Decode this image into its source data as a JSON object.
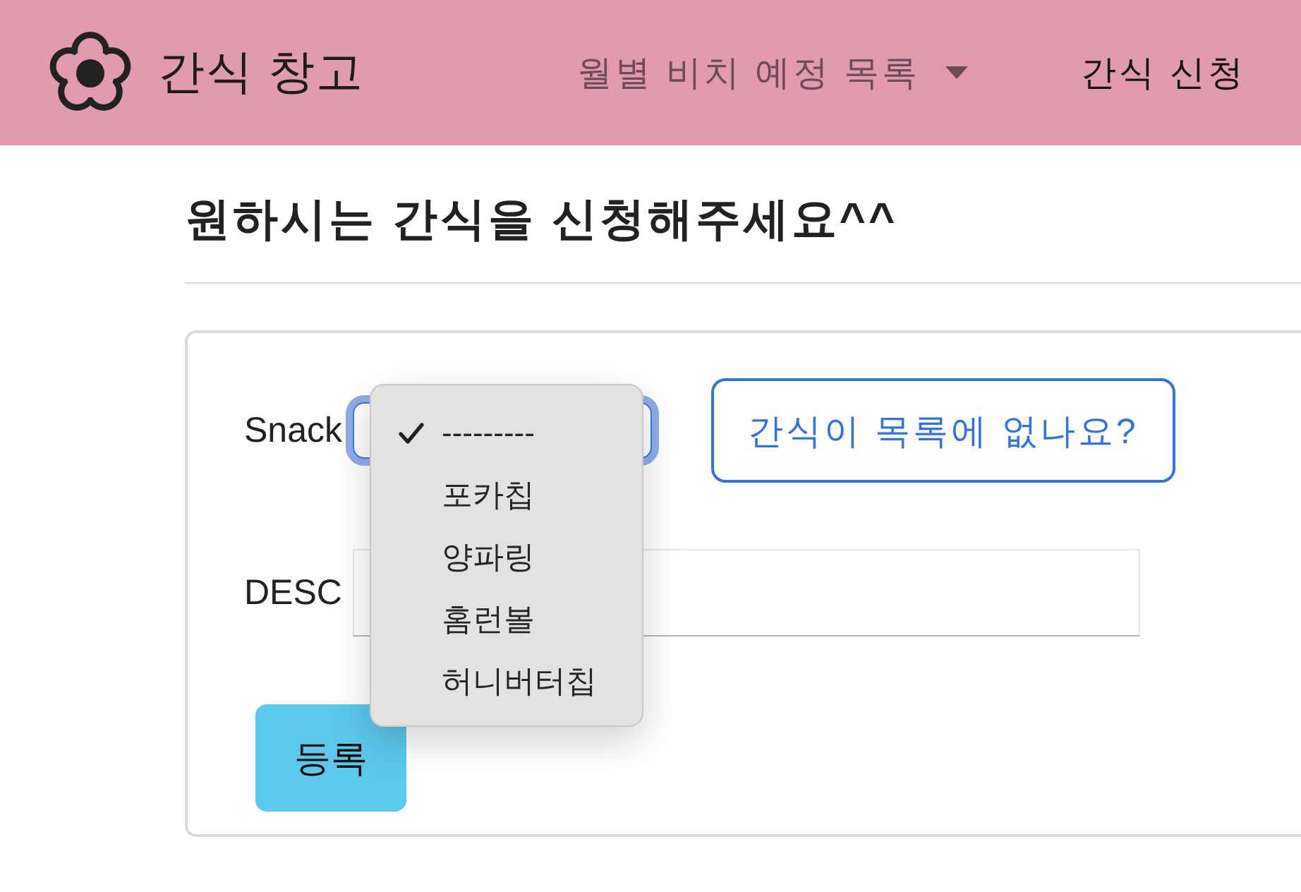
{
  "navbar": {
    "brand": "간식 창고",
    "links": [
      {
        "label": "월별 비치 예정 목록",
        "kind": "dropdown",
        "active": false
      },
      {
        "label": "간식 신청",
        "kind": "link",
        "active": true
      }
    ]
  },
  "page": {
    "heading": "원하시는 간식을 신청해주세요^^"
  },
  "form": {
    "fields": [
      {
        "kind": "select",
        "label": "Snack",
        "focused": true,
        "action": "간식이 목록에 없나요?",
        "menu": {
          "open": true,
          "options": [
            {
              "label": "---------",
              "selected": true
            },
            {
              "label": "포카칩",
              "selected": false
            },
            {
              "label": "양파링",
              "selected": false
            },
            {
              "label": "홈런볼",
              "selected": false
            },
            {
              "label": "허니버터칩",
              "selected": false
            }
          ]
        }
      },
      {
        "kind": "text",
        "label": "DESC"
      }
    ],
    "submit": "등록"
  }
}
